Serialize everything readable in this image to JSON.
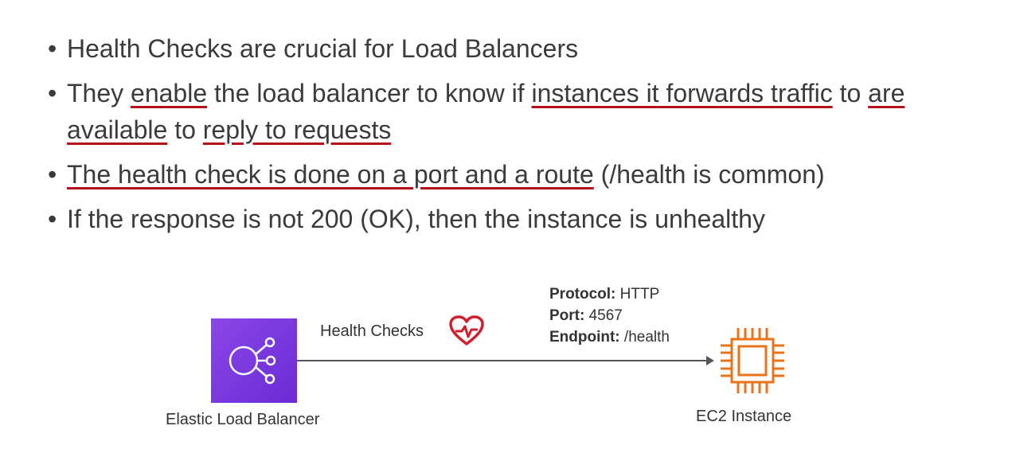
{
  "bullets": [
    {
      "parts": [
        {
          "text": "Health Checks are crucial for Load Balancers",
          "u": false
        }
      ]
    },
    {
      "parts": [
        {
          "text": "They ",
          "u": false
        },
        {
          "text": "enable",
          "u": true
        },
        {
          "text": " the load balancer to know if ",
          "u": false
        },
        {
          "text": "instances it forwards traffic",
          "u": true
        },
        {
          "text": " to ",
          "u": false
        },
        {
          "text": "are available",
          "u": true
        },
        {
          "text": " to ",
          "u": false
        },
        {
          "text": "reply to requests",
          "u": true
        }
      ]
    },
    {
      "parts": [
        {
          "text": "The health check is done on a port and a route",
          "u": true
        },
        {
          "text": " (/health is common)",
          "u": false
        }
      ]
    },
    {
      "parts": [
        {
          "text": "If the response is not 200 (OK), then the instance is unhealthy",
          "u": false
        }
      ]
    }
  ],
  "diagram": {
    "elb_label": "Elastic Load Balancer",
    "health_checks_label": "Health Checks",
    "protocol_key": "Protocol:",
    "protocol_value": " HTTP",
    "port_key": "Port:",
    "port_value": " 4567",
    "endpoint_key": "Endpoint:",
    "endpoint_value": " /health",
    "ec2_label": "EC2 Instance"
  },
  "colors": {
    "underline": "#b3121b",
    "elb": "#7b3fe4",
    "ec2": "#e8731a",
    "heart": "#d0202e"
  },
  "icons": {
    "elb": "load-balancer-icon",
    "heart": "heartbeat-icon",
    "ec2": "chip-icon"
  }
}
